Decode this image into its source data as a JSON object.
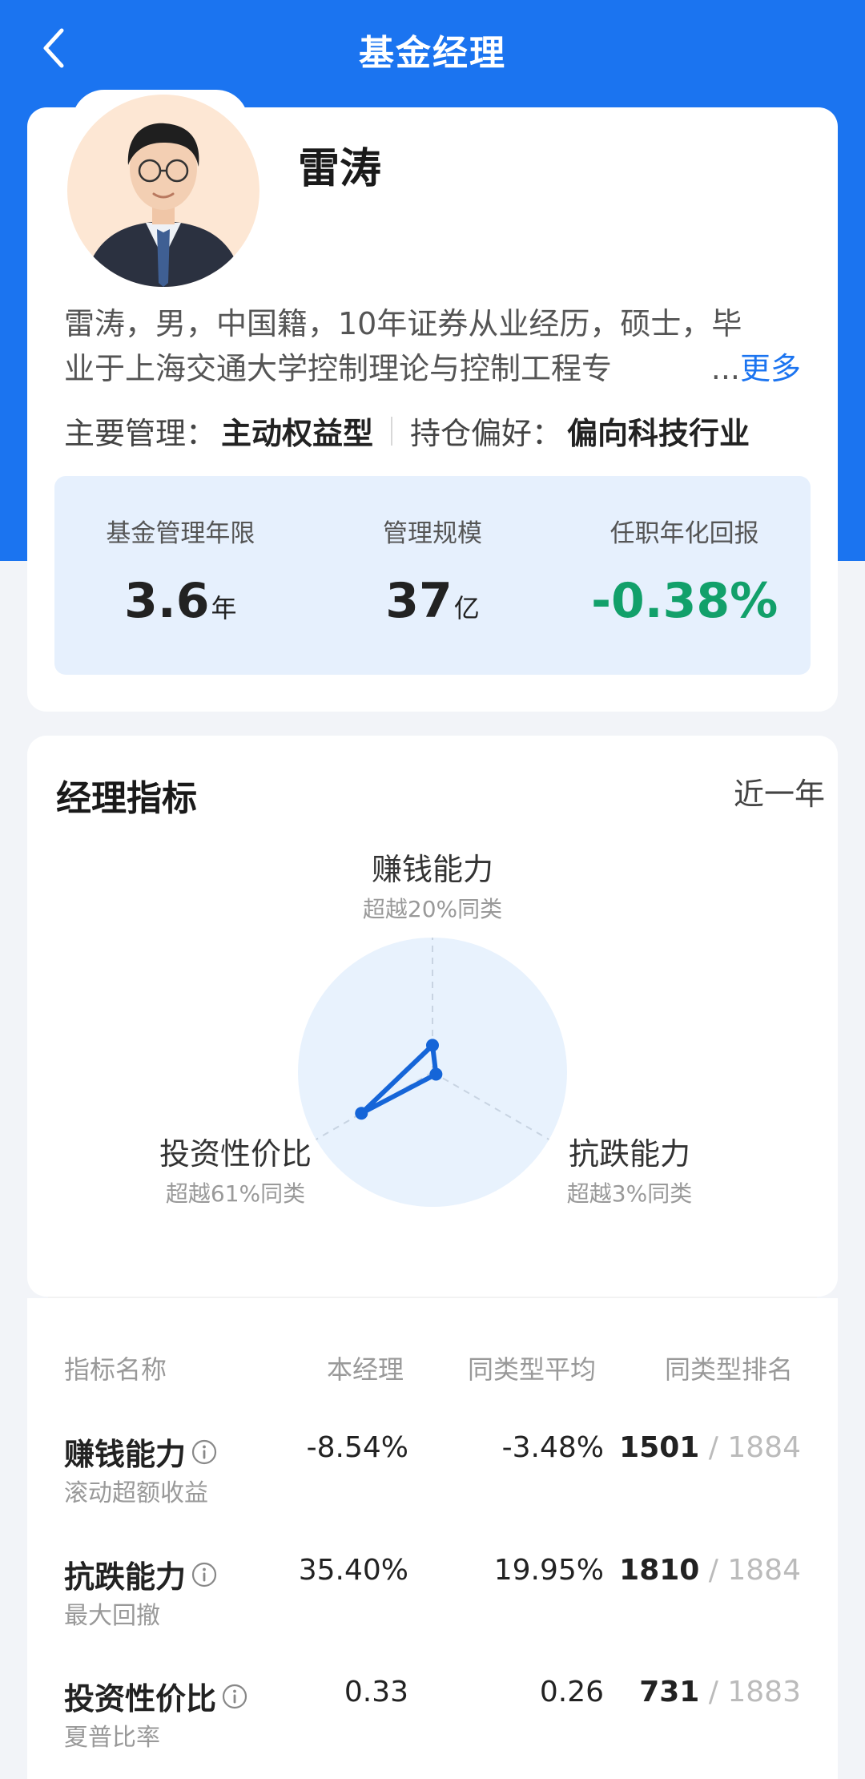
{
  "header": {
    "title": "基金经理",
    "back_icon": "chevron-left-icon"
  },
  "profile": {
    "name": "雷涛",
    "bio_line1": "雷涛，男，中国籍，10年证券从业经历，硕士，毕",
    "bio_line2": "业于上海交通大学控制理论与控制工程专",
    "bio_ellipsis": "...",
    "more_label": "更多",
    "main_manage_label": "主要管理：",
    "main_manage_value": "主动权益型",
    "preference_label": "持仓偏好：",
    "preference_value": "偏向科技行业"
  },
  "stats": [
    {
      "label": "基金管理年限",
      "value": "3.6",
      "unit": "年"
    },
    {
      "label": "管理规模",
      "value": "37",
      "unit": "亿"
    },
    {
      "label": "任职年化回报",
      "value": "-0.38%",
      "unit": ""
    }
  ],
  "indicators": {
    "title": "经理指标",
    "period": "近一年",
    "radar": [
      {
        "name": "赚钱能力",
        "sub": "超越20%同类",
        "level": 0.2
      },
      {
        "name": "抗跌能力",
        "sub": "超越3%同类",
        "level": 0.03
      },
      {
        "name": "投资性价比",
        "sub": "超越61%同类",
        "level": 0.61
      }
    ]
  },
  "table": {
    "headers": [
      "指标名称",
      "本经理",
      "同类型平均",
      "同类型排名"
    ],
    "rows": [
      {
        "name": "赚钱能力",
        "sub": "滚动超额收益",
        "mine": "-8.54%",
        "avg": "-3.48%",
        "rank": "1501",
        "total": "1884"
      },
      {
        "name": "抗跌能力",
        "sub": "最大回撤",
        "mine": "35.40%",
        "avg": "19.95%",
        "rank": "1810",
        "total": "1884"
      },
      {
        "name": "投资性价比",
        "sub": "夏普比率",
        "mine": "0.33",
        "avg": "0.26",
        "rank": "731",
        "total": "1883"
      }
    ],
    "rank_separator": " / "
  },
  "colors": {
    "brand": "#1b74f0",
    "negative_green": "#12a06a"
  }
}
